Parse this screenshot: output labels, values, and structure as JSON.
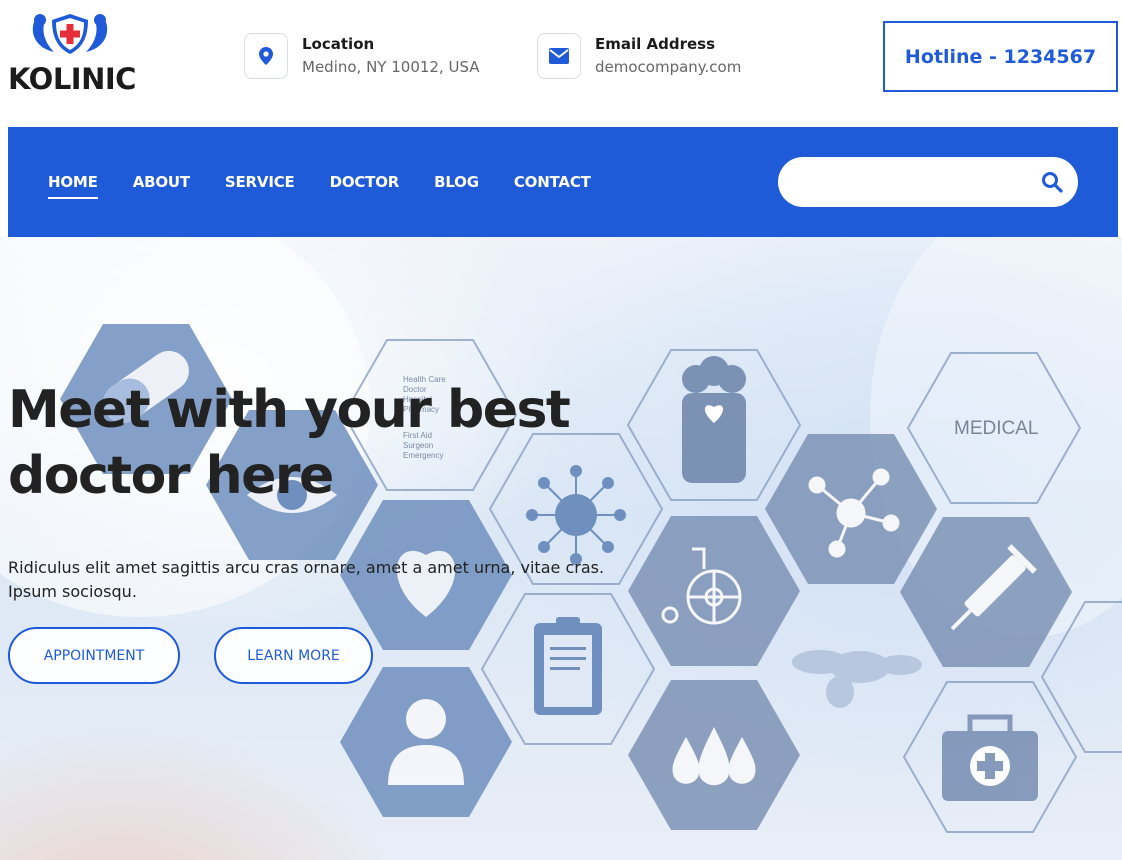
{
  "brand": {
    "name": "KOLINIC",
    "primary_color": "#1f5bd8",
    "logo_icon": "shield-cross-icon"
  },
  "header": {
    "location": {
      "title": "Location",
      "value": "Medino, NY 10012, USA",
      "icon": "map-pin-icon"
    },
    "email": {
      "title": "Email Address",
      "value": "democompany.com",
      "icon": "envelope-icon"
    },
    "hotline": "Hotline - 1234567"
  },
  "nav": {
    "items": [
      {
        "label": "HOME",
        "active": true
      },
      {
        "label": "ABOUT"
      },
      {
        "label": "SERVICE"
      },
      {
        "label": "DOCTOR"
      },
      {
        "label": "BLOG"
      },
      {
        "label": "CONTACT"
      }
    ],
    "search": {
      "placeholder": "",
      "icon": "search-icon"
    }
  },
  "hero": {
    "title_line1": "Meet with your best",
    "title_line2": "doctor here",
    "description": "Ridiculus elit amet sagittis arcu cras ornare, amet a amet urna, vitae cras. Ipsum sociosqu.",
    "buttons": {
      "appointment": "APPOINTMENT",
      "learn_more": "LEARN MORE"
    },
    "hex_labels": {
      "medical": "MEDICAL",
      "list": [
        "Health Care",
        "Doctor",
        "Hospital",
        "Pharmacy",
        "First Aid",
        "Surgeon",
        "Emergency"
      ]
    }
  }
}
